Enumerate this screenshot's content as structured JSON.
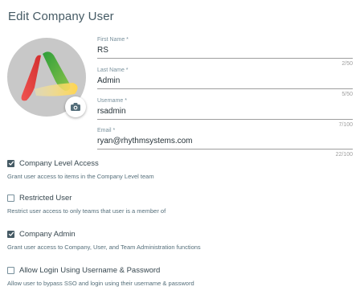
{
  "page": {
    "title": "Edit Company User"
  },
  "avatar": {
    "icon": "logo-image",
    "camera_icon": "camera-icon"
  },
  "fields": [
    {
      "label": "First Name *",
      "value": "RS",
      "counter": "2/50"
    },
    {
      "label": "Last Name *",
      "value": "Admin",
      "counter": "5/50"
    },
    {
      "label": "Username *",
      "value": "rsadmin",
      "counter": "7/100"
    },
    {
      "label": "Email *",
      "value": "ryan@rhythmsystems.com",
      "counter": "22/100"
    }
  ],
  "options": [
    {
      "label": "Company Level Access",
      "checked": true,
      "description": "Grant user access to items in the Company Level team"
    },
    {
      "label": "Restricted User",
      "checked": false,
      "description": "Restrict user access to only teams that user is a member of"
    },
    {
      "label": "Company Admin",
      "checked": true,
      "description": "Grant user access to Company, User, and Team Administration functions"
    },
    {
      "label": "Allow Login Using Username & Password",
      "checked": false,
      "description": "Allow user to bypass SSO and login using their username & password"
    }
  ],
  "colors": {
    "checkbox_on": "#455a64",
    "checkbox_off_border": "#78909c",
    "text": "#37474f"
  }
}
